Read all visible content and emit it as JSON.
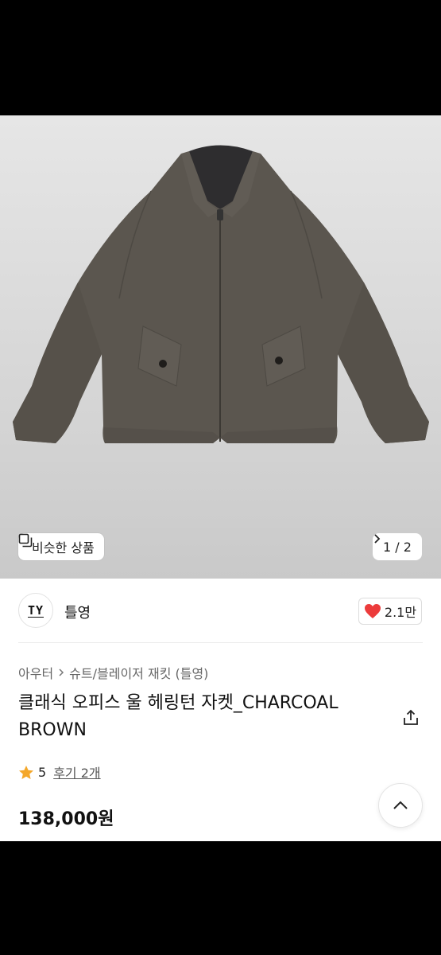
{
  "image_overlay": {
    "similar_label": "비슷한 상품",
    "pager_text": "1 / 2"
  },
  "store": {
    "logo_text": "TY",
    "name": "틀영",
    "like_count": "2.1만"
  },
  "breadcrumb": {
    "category": "아우터",
    "subcategory": "슈트/블레이저 재킷 (틀영)"
  },
  "product": {
    "title": "클래식 오피스 울 헤링턴 자켓_CHARCOAL BROWN",
    "rating": "5",
    "reviews": "후기 2개",
    "price": "138,000원"
  },
  "colors": {
    "heart": "#ec3b3b",
    "star": "#f4a72a",
    "jacket": "#5b564f"
  },
  "icons": {
    "similar": "copy-icon",
    "pager_next": "chevron-right-icon",
    "like": "heart-icon",
    "crumb_sep": "chevron-right-icon",
    "share": "share-icon",
    "rating": "star-icon",
    "scroll_top": "chevron-up-icon"
  }
}
